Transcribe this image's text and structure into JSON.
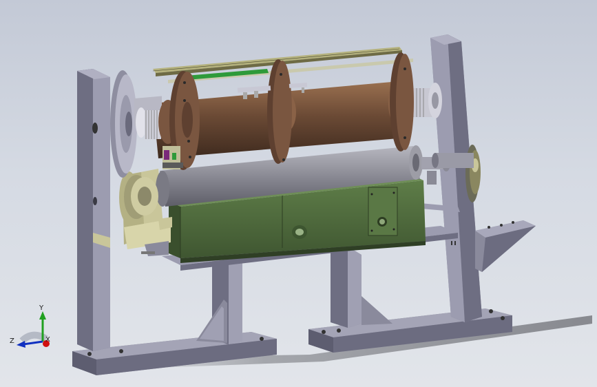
{
  "app": {
    "view": "isometric-3d-model-viewport"
  },
  "colors": {
    "background_top": "#c3c9d6",
    "background_bottom": "#e2e5ea",
    "frame": "#77778a",
    "frame_light": "#9a9aae",
    "frame_dark": "#55556a",
    "drum": "#6b4a35",
    "drum_light": "#8a6247",
    "disc": "#7a5640",
    "housing": "#4f6b3d",
    "housing_dark": "#3d5530",
    "roller": "#8e8e98",
    "bracket": "#c9c69a",
    "green_rod": "#2e9a3a",
    "x_axis": "#d01010",
    "y_axis": "#20a020",
    "z_axis": "#1030c0"
  },
  "triad": {
    "x_label": "X",
    "y_label": "Y",
    "z_label": "Z"
  }
}
